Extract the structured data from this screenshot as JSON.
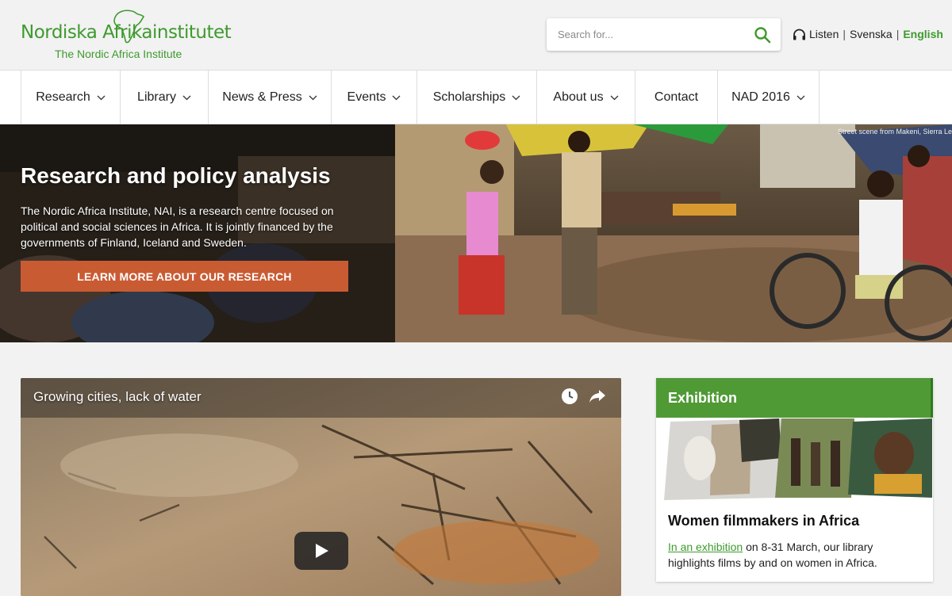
{
  "header": {
    "logo_text": "Nordiska Afrikainstitutet",
    "logo_subtitle": "The Nordic Africa Institute",
    "search_placeholder": "Search for...",
    "listen": "Listen",
    "lang_sv": "Svenska",
    "lang_en": "English",
    "accent_color": "#3e9a2e"
  },
  "nav": {
    "items": [
      {
        "label": "Research",
        "dropdown": true
      },
      {
        "label": "Library",
        "dropdown": true
      },
      {
        "label": "News & Press",
        "dropdown": true
      },
      {
        "label": "Events",
        "dropdown": true
      },
      {
        "label": "Scholarships",
        "dropdown": true
      },
      {
        "label": "About us",
        "dropdown": true
      },
      {
        "label": "Contact",
        "dropdown": false
      },
      {
        "label": "NAD 2016",
        "dropdown": true
      }
    ]
  },
  "hero": {
    "title": "Research and policy analysis",
    "text": "The Nordic Africa Institute, NAI, is a research centre focused on political and social sciences in Africa. It is jointly financed by the governments of Finland, Iceland and Sweden.",
    "button": "LEARN MORE ABOUT OUR RESEARCH",
    "credit": "Street scene from Makeni, Sierra Le",
    "button_color": "#c95b33"
  },
  "video": {
    "title": "Growing cities, lack of water"
  },
  "exhibition": {
    "header": "Exhibition",
    "title": "Women filmmakers in Africa",
    "link": "In an exhibition",
    "text": " on 8-31 March, our library highlights films by and on women in Africa."
  }
}
